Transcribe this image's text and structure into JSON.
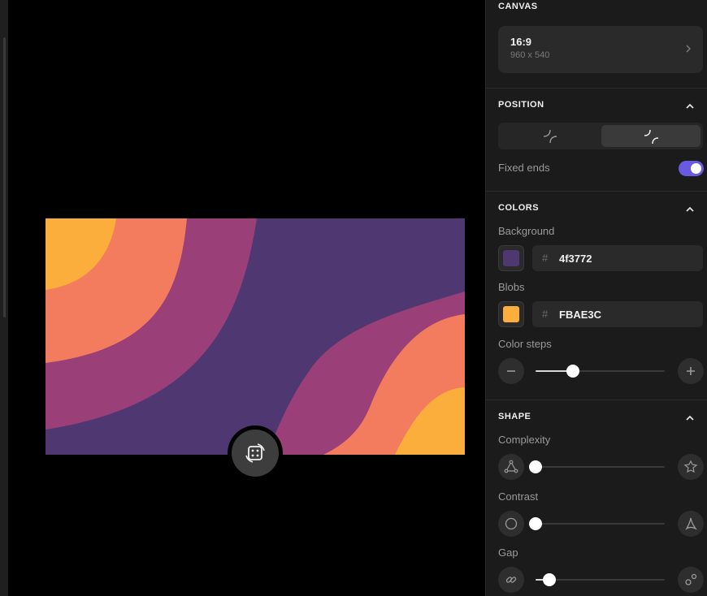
{
  "colors": {
    "accent": "#6a5ae0",
    "panel": "#1b1b1b",
    "art_bands": [
      "#4f3772",
      "#9a3f78",
      "#f47c5e",
      "#fbae3c"
    ]
  },
  "canvas_section": {
    "title": "CANVAS",
    "ratio": "16:9",
    "dims": "960 x 540",
    "icon": "chevron-right-icon"
  },
  "position_section": {
    "title": "POSITION",
    "options": [
      {
        "icon": "corner-curves-icon",
        "active": false
      },
      {
        "icon": "split-curves-icon",
        "active": true
      }
    ],
    "fixed_ends_label": "Fixed ends",
    "fixed_ends_on": true
  },
  "colors_section": {
    "title": "COLORS",
    "background_label": "Background",
    "background_hash": "#",
    "background_hex": "4f3772",
    "background_color": "#4f3772",
    "blobs_label": "Blobs",
    "blobs_hash": "#",
    "blobs_hex": "FBAE3C",
    "blobs_color": "#FBAE3C",
    "color_steps_label": "Color steps",
    "color_steps_value": 0.29
  },
  "shape_section": {
    "title": "SHAPE",
    "complexity_label": "Complexity",
    "complexity_value": 0.0,
    "contrast_label": "Contrast",
    "contrast_value": 0.0,
    "gap_label": "Gap",
    "gap_value": 0.11
  },
  "randomize": {
    "icon": "dice-icon"
  }
}
